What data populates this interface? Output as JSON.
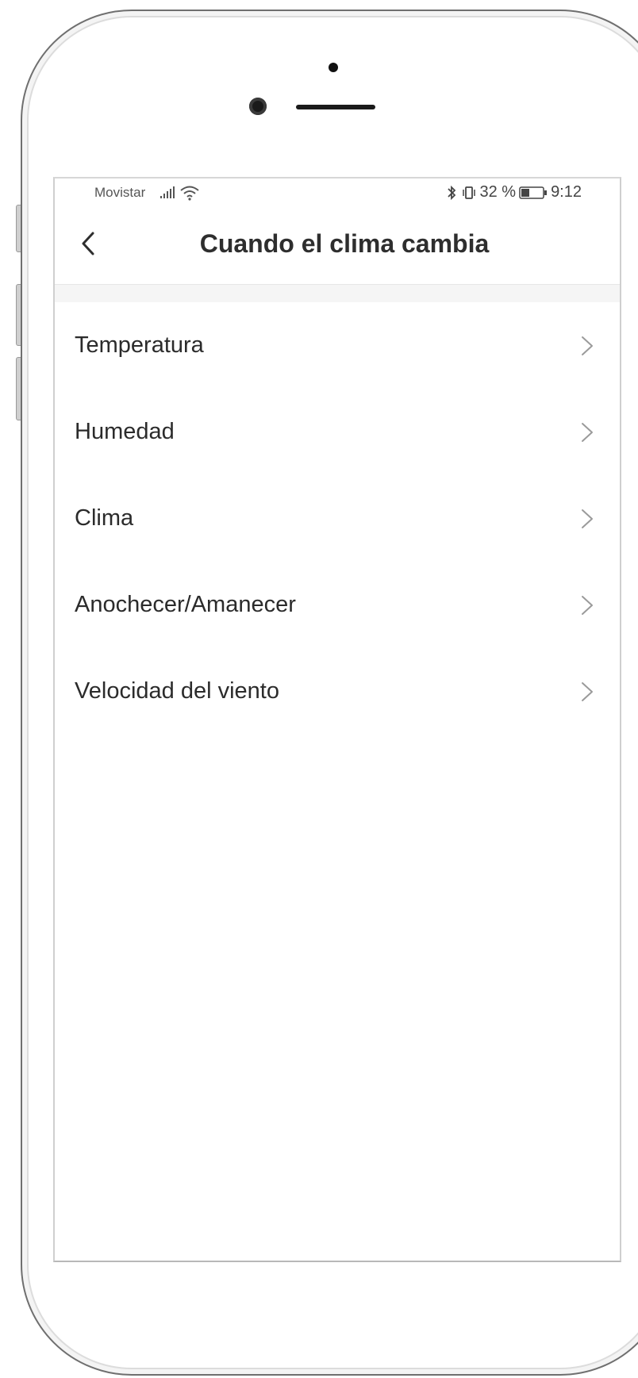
{
  "status_bar": {
    "carrier": "Movistar",
    "battery_percent": "32 %",
    "time": "9:12",
    "icons": [
      "signal-icon",
      "wifi-icon",
      "bluetooth-icon",
      "vibrate-icon",
      "battery-icon"
    ]
  },
  "header": {
    "title": "Cuando el clima cambia",
    "back_icon": "chevron-left-icon"
  },
  "list": {
    "items": [
      {
        "label": "Temperatura"
      },
      {
        "label": "Humedad"
      },
      {
        "label": "Clima"
      },
      {
        "label": "Anochecer/Amanecer"
      },
      {
        "label": "Velocidad del viento"
      }
    ]
  },
  "colors": {
    "text_primary": "#2b2b2b",
    "chevron": "#9a9a9a",
    "divider": "#e6e6e6",
    "section_gap": "#f5f5f5"
  }
}
